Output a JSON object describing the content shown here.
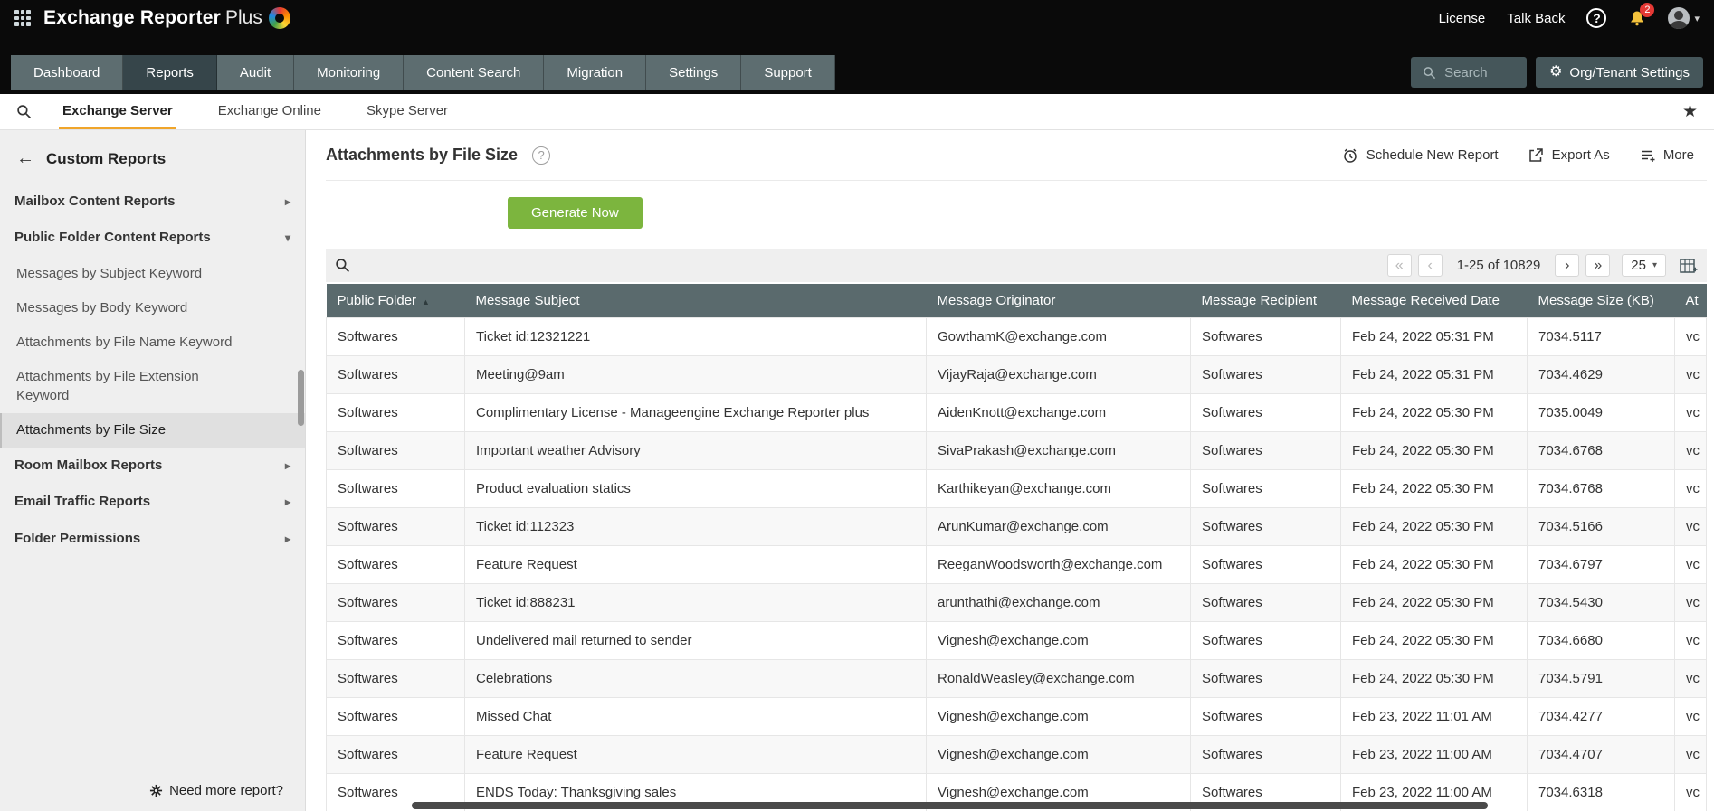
{
  "icons": {
    "help_glyph": "?",
    "star": "★",
    "gear": "⚙",
    "back_arrow": "←",
    "caret_down": "▾",
    "pg_first": "«",
    "pg_prev": "‹",
    "pg_next": "›",
    "pg_last": "»"
  },
  "topbar": {
    "title_main": "Exchange Reporter",
    "title_plus": "Plus",
    "license_label": "License",
    "talkback_label": "Talk Back",
    "notification_count": "2"
  },
  "nav": {
    "items": [
      {
        "label": "Dashboard"
      },
      {
        "label": "Reports",
        "active": true
      },
      {
        "label": "Audit"
      },
      {
        "label": "Monitoring"
      },
      {
        "label": "Content Search"
      },
      {
        "label": "Migration"
      },
      {
        "label": "Settings"
      },
      {
        "label": "Support"
      }
    ],
    "search_placeholder": "Search",
    "org_settings_label": "Org/Tenant Settings"
  },
  "subnav": {
    "tabs": [
      {
        "label": "Exchange Server",
        "active": true
      },
      {
        "label": "Exchange Online"
      },
      {
        "label": "Skype Server"
      }
    ]
  },
  "sidebar": {
    "title": "Custom Reports",
    "items": [
      {
        "label": "Mailbox Content Reports",
        "type": "category",
        "chevron": "▸"
      },
      {
        "label": "Public Folder Content Reports",
        "type": "category",
        "chevron": "▾"
      },
      {
        "label": "Messages by Subject Keyword",
        "type": "sub",
        "chevron": ""
      },
      {
        "label": "Messages by Body Keyword",
        "type": "sub",
        "chevron": ""
      },
      {
        "label": "Attachments by File Name Keyword",
        "type": "sub",
        "chevron": ""
      },
      {
        "label": "Attachments by File Extension Keyword",
        "type": "sub",
        "chevron": ""
      },
      {
        "label": "Attachments by File Size",
        "type": "sub",
        "chevron": "",
        "selected": true
      },
      {
        "label": "Room Mailbox Reports",
        "type": "category",
        "chevron": "▸"
      },
      {
        "label": "Email Traffic Reports",
        "type": "category",
        "chevron": "▸"
      },
      {
        "label": "Folder Permissions",
        "type": "category",
        "chevron": "▸"
      }
    ],
    "footer_label": "Need more report?"
  },
  "main": {
    "title": "Attachments by File Size",
    "actions": {
      "schedule": "Schedule New Report",
      "export": "Export As",
      "more": "More"
    },
    "generate_label": "Generate Now",
    "pagination": {
      "range": "1-25 of 10829",
      "page_size": "25"
    },
    "table": {
      "columns": [
        {
          "label": "Public Folder",
          "sort_icon": "▲"
        },
        {
          "label": "Message Subject",
          "sort_icon": ""
        },
        {
          "label": "Message Originator",
          "sort_icon": ""
        },
        {
          "label": "Message Recipient",
          "sort_icon": ""
        },
        {
          "label": "Message Received Date",
          "sort_icon": ""
        },
        {
          "label": "Message Size (KB)",
          "sort_icon": ""
        },
        {
          "label": "At",
          "sort_icon": ""
        }
      ],
      "rows": [
        [
          "Softwares",
          "Ticket id:12321221",
          "GowthamK@exchange.com",
          "Softwares",
          "Feb 24, 2022 05:31 PM",
          "7034.5117",
          "vc"
        ],
        [
          "Softwares",
          "Meeting@9am",
          "VijayRaja@exchange.com",
          "Softwares",
          "Feb 24, 2022 05:31 PM",
          "7034.4629",
          "vc"
        ],
        [
          "Softwares",
          "Complimentary License - Manageengine Exchange Reporter plus",
          "AidenKnott@exchange.com",
          "Softwares",
          "Feb 24, 2022 05:30 PM",
          "7035.0049",
          "vc"
        ],
        [
          "Softwares",
          "Important weather Advisory",
          "SivaPrakash@exchange.com",
          "Softwares",
          "Feb 24, 2022 05:30 PM",
          "7034.6768",
          "vc"
        ],
        [
          "Softwares",
          "Product evaluation statics",
          "Karthikeyan@exchange.com",
          "Softwares",
          "Feb 24, 2022 05:30 PM",
          "7034.6768",
          "vc"
        ],
        [
          "Softwares",
          "Ticket id:112323",
          "ArunKumar@exchange.com",
          "Softwares",
          "Feb 24, 2022 05:30 PM",
          "7034.5166",
          "vc"
        ],
        [
          "Softwares",
          "Feature Request",
          "ReeganWoodsworth@exchange.com",
          "Softwares",
          "Feb 24, 2022 05:30 PM",
          "7034.6797",
          "vc"
        ],
        [
          "Softwares",
          "Ticket id:888231",
          "arunthathi@exchange.com",
          "Softwares",
          "Feb 24, 2022 05:30 PM",
          "7034.5430",
          "vc"
        ],
        [
          "Softwares",
          "Undelivered mail returned to sender",
          "Vignesh@exchange.com",
          "Softwares",
          "Feb 24, 2022 05:30 PM",
          "7034.6680",
          "vc"
        ],
        [
          "Softwares",
          "Celebrations",
          "RonaldWeasley@exchange.com",
          "Softwares",
          "Feb 24, 2022 05:30 PM",
          "7034.5791",
          "vc"
        ],
        [
          "Softwares",
          "Missed Chat",
          "Vignesh@exchange.com",
          "Softwares",
          "Feb 23, 2022 11:01 AM",
          "7034.4277",
          "vc"
        ],
        [
          "Softwares",
          "Feature Request",
          "Vignesh@exchange.com",
          "Softwares",
          "Feb 23, 2022 11:00 AM",
          "7034.4707",
          "vc"
        ],
        [
          "Softwares",
          "ENDS Today: Thanksgiving sales",
          "Vignesh@exchange.com",
          "Softwares",
          "Feb 23, 2022 11:00 AM",
          "7034.6318",
          "vc"
        ]
      ]
    }
  }
}
